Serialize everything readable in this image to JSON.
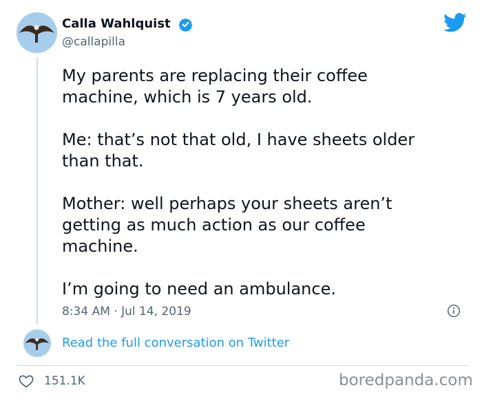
{
  "author": {
    "name": "Calla Wahlquist",
    "handle": "@callapilla",
    "avatar_icon": "hawk-avatar",
    "verified_icon": "verified-badge-icon"
  },
  "tweet": {
    "paragraphs": [
      "My parents are replacing their coffee\nmachine, which is 7 years old.",
      "Me: that’s not that old, I have sheets older\nthan that.",
      "Mother: well perhaps your sheets aren’t\ngetting as much action as our coffee\nmachine.",
      "I’m going to need an ambulance."
    ],
    "timestamp": "8:34 AM · Jul 14, 2019"
  },
  "conversation": {
    "link_label": "Read the full conversation on Twitter"
  },
  "footer": {
    "likes": "151.1K",
    "watermark": "boredpanda.com"
  },
  "colors": {
    "accent": "#1d9bf0",
    "muted": "#536471",
    "divider": "#cfd9de"
  }
}
